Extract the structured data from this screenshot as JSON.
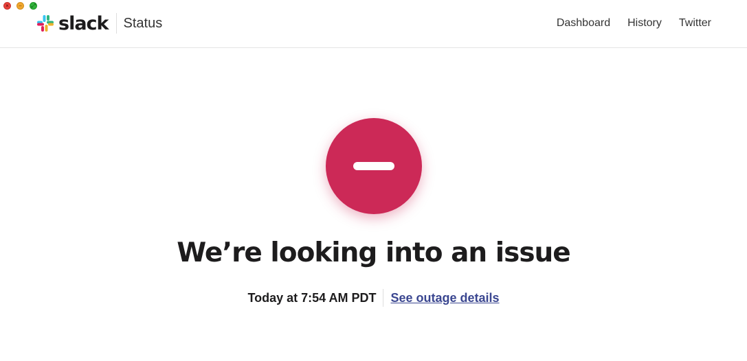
{
  "window": {
    "controls": [
      "close",
      "minimize",
      "maximize"
    ]
  },
  "header": {
    "brand": {
      "wordmark": "slack",
      "product": "Status",
      "logo_icon": "slack-hash-logo",
      "logo_colors": [
        "#36c5f0",
        "#2eb67d",
        "#ecb22e",
        "#e01e5a"
      ]
    },
    "nav": [
      {
        "label": "Dashboard"
      },
      {
        "label": "History"
      },
      {
        "label": "Twitter"
      }
    ]
  },
  "status": {
    "icon": "minus-circle-icon",
    "color": "#cc2957",
    "headline": "We’re looking into an issue",
    "timestamp": "Today at 7:54 AM PDT",
    "details_link": "See outage details",
    "link_color": "#3a4690"
  }
}
